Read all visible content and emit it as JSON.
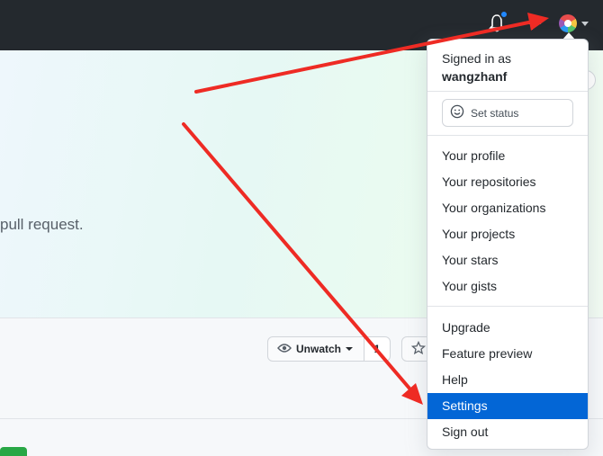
{
  "hero": {
    "text": "pull request."
  },
  "repo_actions": {
    "watch_label": "Unwatch",
    "watch_count": "1"
  },
  "user_menu": {
    "signed_in_label": "Signed in as",
    "username": "wangzhanf",
    "set_status_label": "Set status",
    "items": [
      {
        "label": "Your profile"
      },
      {
        "label": "Your repositories"
      },
      {
        "label": "Your organizations"
      },
      {
        "label": "Your projects"
      },
      {
        "label": "Your stars"
      },
      {
        "label": "Your gists"
      },
      {
        "label": "Upgrade"
      },
      {
        "label": "Feature preview"
      },
      {
        "label": "Help"
      },
      {
        "label": "Settings",
        "active": true
      },
      {
        "label": "Sign out"
      }
    ]
  },
  "colors": {
    "header": "#24292e",
    "accent": "#0366d6",
    "notification_dot": "#2188ff",
    "annotation_arrow": "#ee2b24"
  },
  "icons": [
    "bell-icon",
    "plus-icon",
    "avatar",
    "smiley-icon",
    "eye-icon",
    "star-icon"
  ]
}
